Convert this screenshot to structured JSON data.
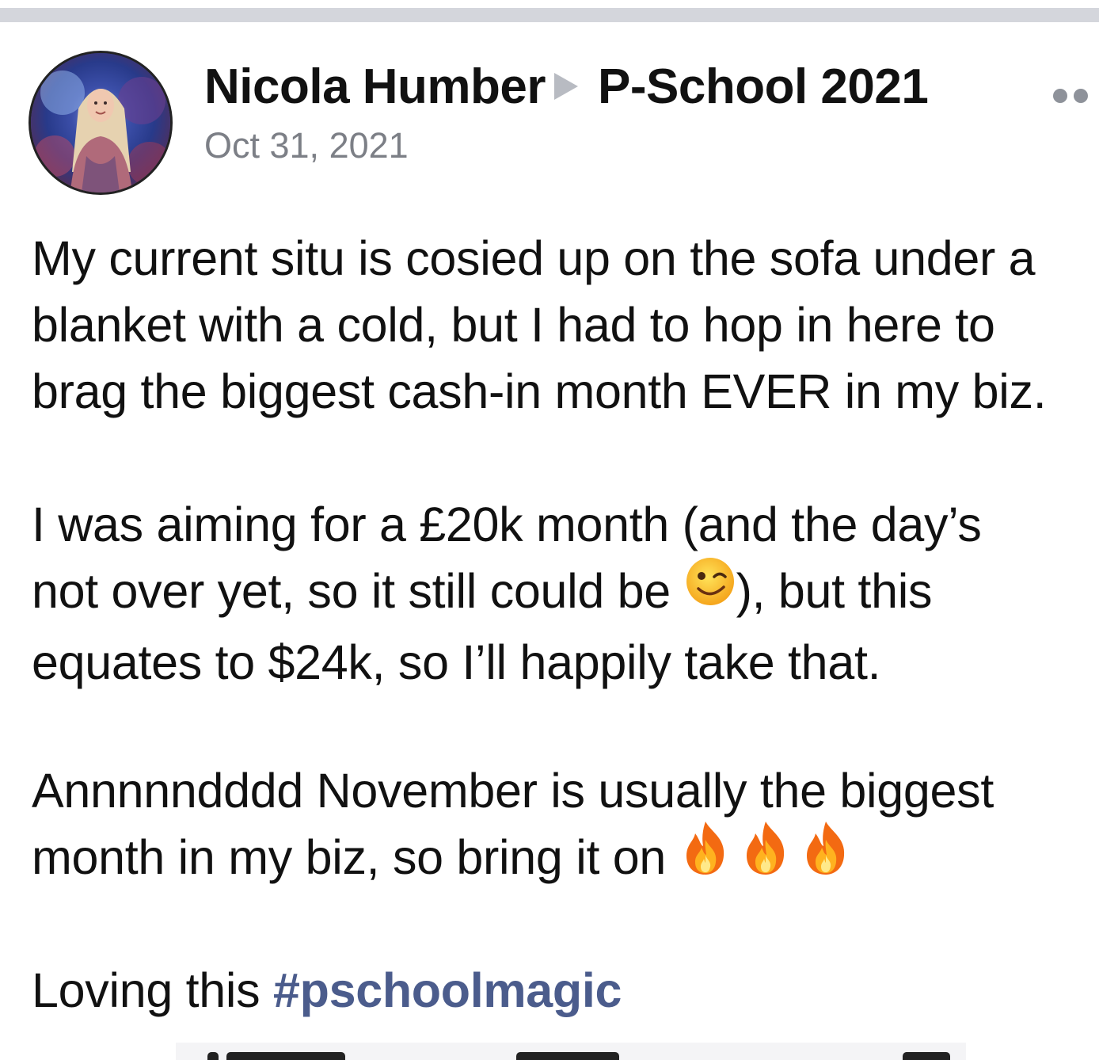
{
  "post": {
    "author": "Nicola Humber",
    "group": "P-School 2021",
    "date": "Oct 31, 2021",
    "paragraphs": {
      "p1": {
        "l1": "My current situ is cosied up on the sofa under a",
        "l2": "blanket with a cold, but I had to hop in here to",
        "l3": "brag the biggest cash-in month EVER in my biz."
      },
      "p2": {
        "l1": "I was aiming for a £20k month (and the day’s",
        "l2a": "not over yet, so it still could be ",
        "l2b": "), but this",
        "l3": "equates to $24k, so I’ll happily take that."
      },
      "p3": {
        "l1": "Annnnndddd November is usually the biggest",
        "l2": "month in my biz, so bring it on "
      },
      "p4": {
        "text": "Loving this ",
        "hashtag": "#pschoolmagic"
      }
    },
    "emojis": [
      "winking-face",
      "fire",
      "fire",
      "fire"
    ]
  },
  "colors": {
    "hashtag": "#4b5c8c",
    "date": "#7c7f86",
    "top_bar": "#d4d6dc",
    "text": "#111111"
  }
}
